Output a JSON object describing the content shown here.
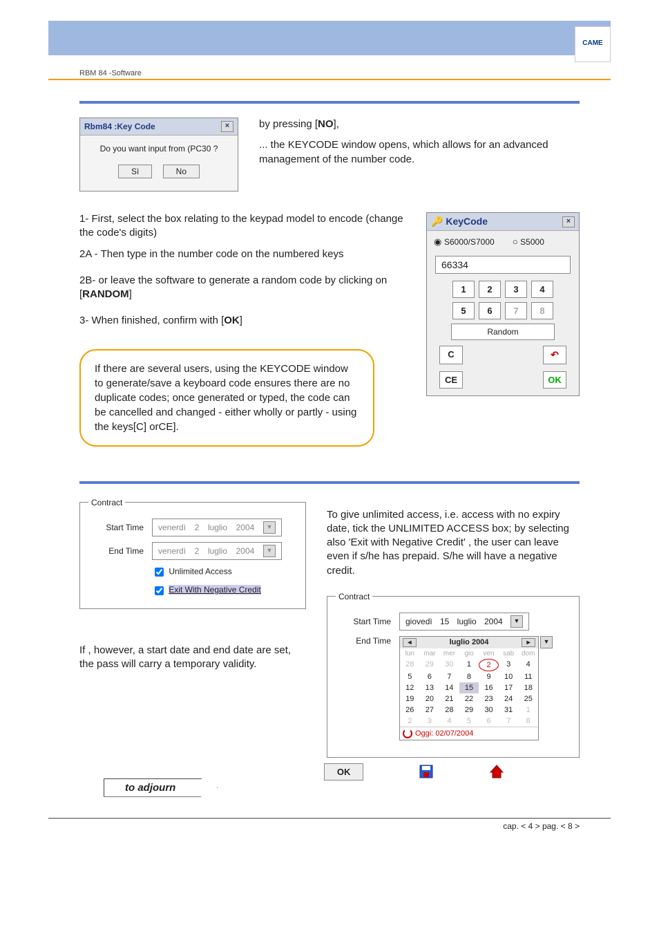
{
  "header_label": "RBM 84 -Software",
  "logo": "CAME",
  "dialog_keycode_prompt": {
    "title": "Rbm84 :Key Code",
    "message": "Do you want input from (PC30 ?",
    "yes": "Sì",
    "no": "No"
  },
  "intro_text_line1_pre": "by pressing [",
  "intro_text_line1_bold": "NO",
  "intro_text_line1_post": "],",
  "intro_text_para": "... the KEYCODE window opens, which allows for an advanced management of the number code.",
  "steps": {
    "s1": "1- First, select the box relating to the keypad model to encode (change the code's digits)",
    "s2a": "2A - Then type in the number code on the numbered keys",
    "s2b_pre": "2B-  or leave the software to generate a random code by clicking on [",
    "s2b_bold": "RANDOM",
    "s2b_post": "]",
    "s3_pre": "3- When finished, confirm with [",
    "s3_bold": "OK",
    "s3_post": "]"
  },
  "note_box": "If there are several users, using the KEYCODE window to generate/save a keyboard code ensures there are no duplicate codes;  once generated or typed, the code can be cancelled and changed - either wholly or partly - using the keys[C] orCE].",
  "keycode_window": {
    "title": "KeyCode",
    "radio1": "S6000/S7000",
    "radio2": "S5000",
    "display": "66334",
    "keys": [
      "1",
      "2",
      "3",
      "4",
      "5",
      "6",
      "7",
      "8"
    ],
    "random": "Random",
    "c": "C",
    "ce": "CE",
    "ok": "OK",
    "undo": "↶"
  },
  "contract1": {
    "legend": "Contract",
    "start_label": "Start Time",
    "end_label": "End Time",
    "start_val": {
      "dow": "venerdì",
      "d": "2",
      "m": "luglio",
      "y": "2004"
    },
    "end_val": {
      "dow": "venerdì",
      "d": "2",
      "m": "luglio",
      "y": "2004"
    },
    "unlimited": "Unlimited Access",
    "negative": "Exit With Negative Credit"
  },
  "right_para": "To give unlimited access, i.e. access with no expiry date,  tick the UNLIMITED ACCESS box; by selecting also 'Exit with Negative Credit' , the user can leave even if s/he has  prepaid. S/he will have a negative credit.",
  "left_para2": "If , however, a start date and end date are set, the pass will carry a temporary validity.",
  "contract2": {
    "legend": "Contract",
    "start_label": "Start Time",
    "end_label": "End Time",
    "start_val": {
      "dow": "giovedì",
      "d": "15",
      "m": "luglio",
      "y": "2004"
    }
  },
  "calendar": {
    "title": "luglio 2004",
    "dow": [
      "lun",
      "mar",
      "mer",
      "gio",
      "ven",
      "sab",
      "dom"
    ],
    "rows": [
      [
        "28",
        "29",
        "30",
        "1",
        "2",
        "3",
        "4"
      ],
      [
        "5",
        "6",
        "7",
        "8",
        "9",
        "10",
        "11"
      ],
      [
        "12",
        "13",
        "14",
        "15",
        "16",
        "17",
        "18"
      ],
      [
        "19",
        "20",
        "21",
        "22",
        "23",
        "24",
        "25"
      ],
      [
        "26",
        "27",
        "28",
        "29",
        "30",
        "31",
        "1"
      ],
      [
        "2",
        "3",
        "4",
        "5",
        "6",
        "7",
        "8"
      ]
    ],
    "off_days_first": [
      0,
      1,
      2
    ],
    "off_days_last5": [
      6
    ],
    "off_days_last6": [
      0,
      1,
      2,
      3,
      4,
      5,
      6
    ],
    "today_cell": "2",
    "sel_cell": "15",
    "footer": "Oggi: 02/07/2004"
  },
  "adjourn": "to adjourn",
  "ok_label": "OK",
  "footer": "cap. < 4 > pag. < 8 >"
}
